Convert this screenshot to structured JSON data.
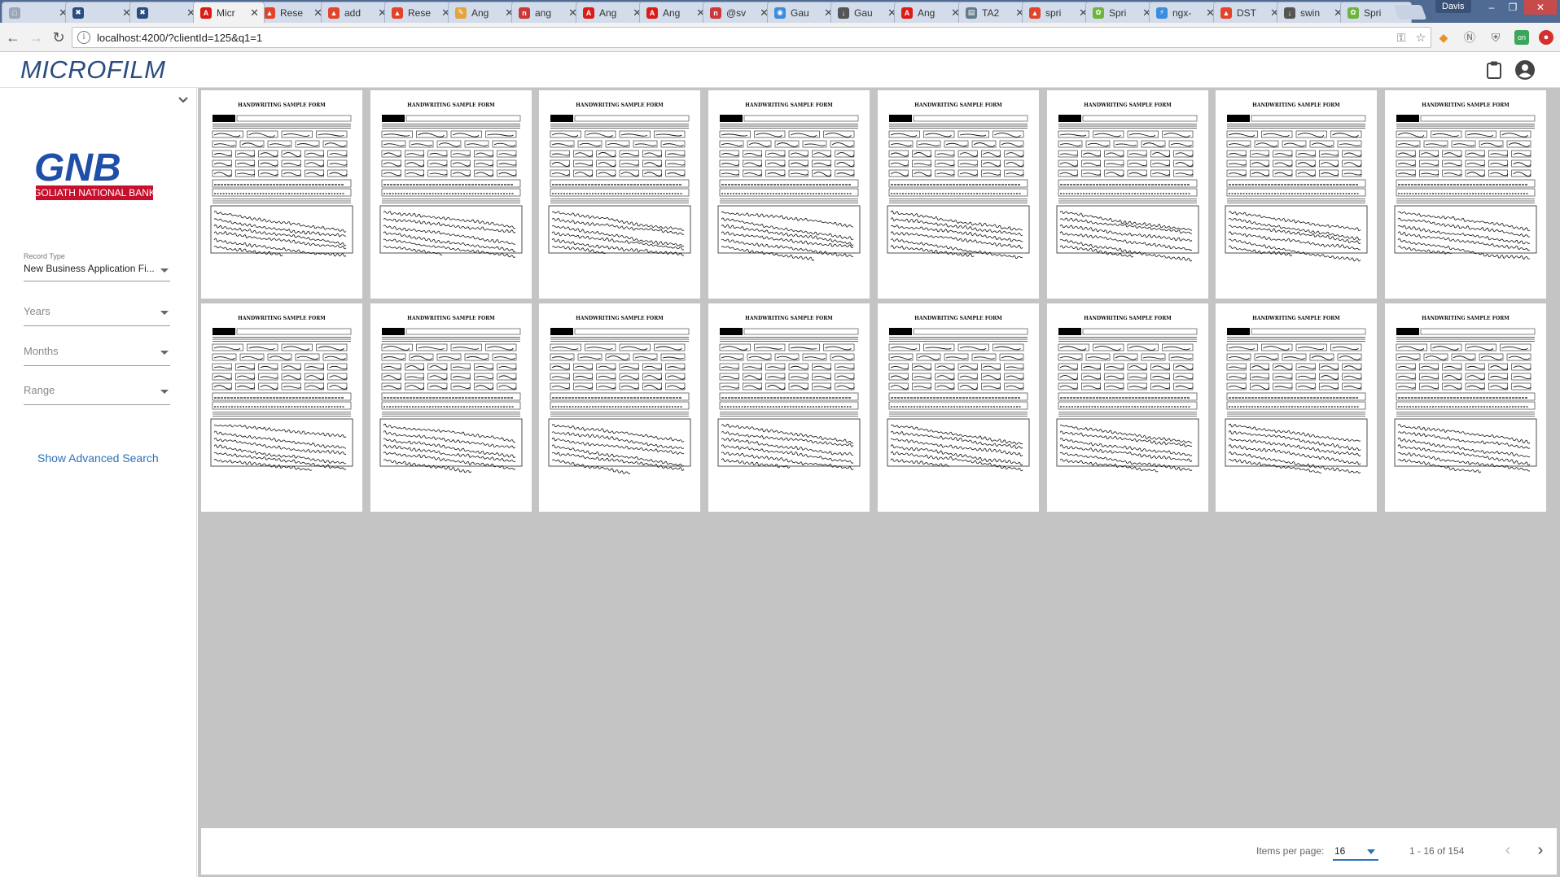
{
  "browser": {
    "tabs": [
      {
        "title": "",
        "favicon": "page-icon",
        "color": "#9aa7ba",
        "active": false
      },
      {
        "title": "",
        "favicon": "tools-icon",
        "color": "#2b4c80",
        "active": false
      },
      {
        "title": "",
        "favicon": "tools-icon",
        "color": "#2b4c80",
        "active": false
      },
      {
        "title": "Micr",
        "favicon": "angular-icon",
        "color": "#dd1b16",
        "active": true
      },
      {
        "title": "Rese",
        "favicon": "gitlab-icon",
        "color": "#e24329",
        "active": false
      },
      {
        "title": "add",
        "favicon": "gitlab-icon",
        "color": "#e24329",
        "active": false
      },
      {
        "title": "Rese",
        "favicon": "gitlab-icon",
        "color": "#e24329",
        "active": false
      },
      {
        "title": "Ang",
        "favicon": "pencil-icon",
        "color": "#e6a23c",
        "active": false
      },
      {
        "title": "ang",
        "favicon": "npm-icon",
        "color": "#cb3837",
        "active": false
      },
      {
        "title": "Ang",
        "favicon": "angular-icon",
        "color": "#dd1b16",
        "active": false
      },
      {
        "title": "Ang",
        "favicon": "angular-icon",
        "color": "#dd1b16",
        "active": false
      },
      {
        "title": "@sv",
        "favicon": "npm-icon",
        "color": "#cb3837",
        "active": false
      },
      {
        "title": "Gau",
        "favicon": "gauge-icon",
        "color": "#3a8dde",
        "active": false
      },
      {
        "title": "Gau",
        "favicon": "download-icon",
        "color": "#555555",
        "active": false
      },
      {
        "title": "Ang",
        "favicon": "angular-icon",
        "color": "#dd1b16",
        "active": false
      },
      {
        "title": "TA2",
        "favicon": "doc-icon",
        "color": "#607d8b",
        "active": false
      },
      {
        "title": "spri",
        "favicon": "gitlab-icon",
        "color": "#e24329",
        "active": false
      },
      {
        "title": "Spri",
        "favicon": "spring-icon",
        "color": "#6db33f",
        "active": false
      },
      {
        "title": "ngx-",
        "favicon": "bolt-icon",
        "color": "#3a8dde",
        "active": false
      },
      {
        "title": "DST",
        "favicon": "gitlab-icon",
        "color": "#e24329",
        "active": false
      },
      {
        "title": "swin",
        "favicon": "download-icon",
        "color": "#555555",
        "active": false
      },
      {
        "title": "Spri",
        "favicon": "spring-icon",
        "color": "#6db33f",
        "active": false
      }
    ],
    "profile_name": "Davis",
    "url": "localhost:4200/?clientId=125&q1=1"
  },
  "app": {
    "brand": "MICROFILM",
    "brand_color": "#2b4c80"
  },
  "sidebar": {
    "logo": {
      "mark": "GNB",
      "name": "GOLIATH NATIONAL BANK",
      "color": "#c8102e",
      "accent": "#1f4fa8"
    },
    "record_type": {
      "label": "Record Type",
      "value": "New Business Application Fi..."
    },
    "years": {
      "placeholder": "Years"
    },
    "months": {
      "placeholder": "Months"
    },
    "range": {
      "placeholder": "Range"
    },
    "advanced_search": "Show Advanced Search"
  },
  "documents": [
    {
      "title": "HANDWRITING SAMPLE FORM"
    },
    {
      "title": "HANDWRITING SAMPLE FORM"
    },
    {
      "title": "HANDWRITING SAMPLE FORM"
    },
    {
      "title": "HANDWRITING SAMPLE FORM"
    },
    {
      "title": "HANDWRITING SAMPLE FORM"
    },
    {
      "title": "HANDWRITING SAMPLE FORM"
    },
    {
      "title": "HANDWRITING SAMPLE FORM"
    },
    {
      "title": "HANDWRITING SAMPLE FORM"
    },
    {
      "title": "HANDWRITING SAMPLE FORM"
    },
    {
      "title": "HANDWRITING SAMPLE FORM"
    },
    {
      "title": "HANDWRITING SAMPLE FORM"
    },
    {
      "title": "HANDWRITING SAMPLE FORM"
    },
    {
      "title": "HANDWRITING SAMPLE FORM"
    },
    {
      "title": "HANDWRITING SAMPLE FORM"
    },
    {
      "title": "HANDWRITING SAMPLE FORM"
    },
    {
      "title": "HANDWRITING SAMPLE FORM"
    }
  ],
  "paginator": {
    "items_per_page_label": "Items per page:",
    "items_per_page": "16",
    "range_label": "1 - 16 of 154",
    "accent": "#2a73b8"
  }
}
